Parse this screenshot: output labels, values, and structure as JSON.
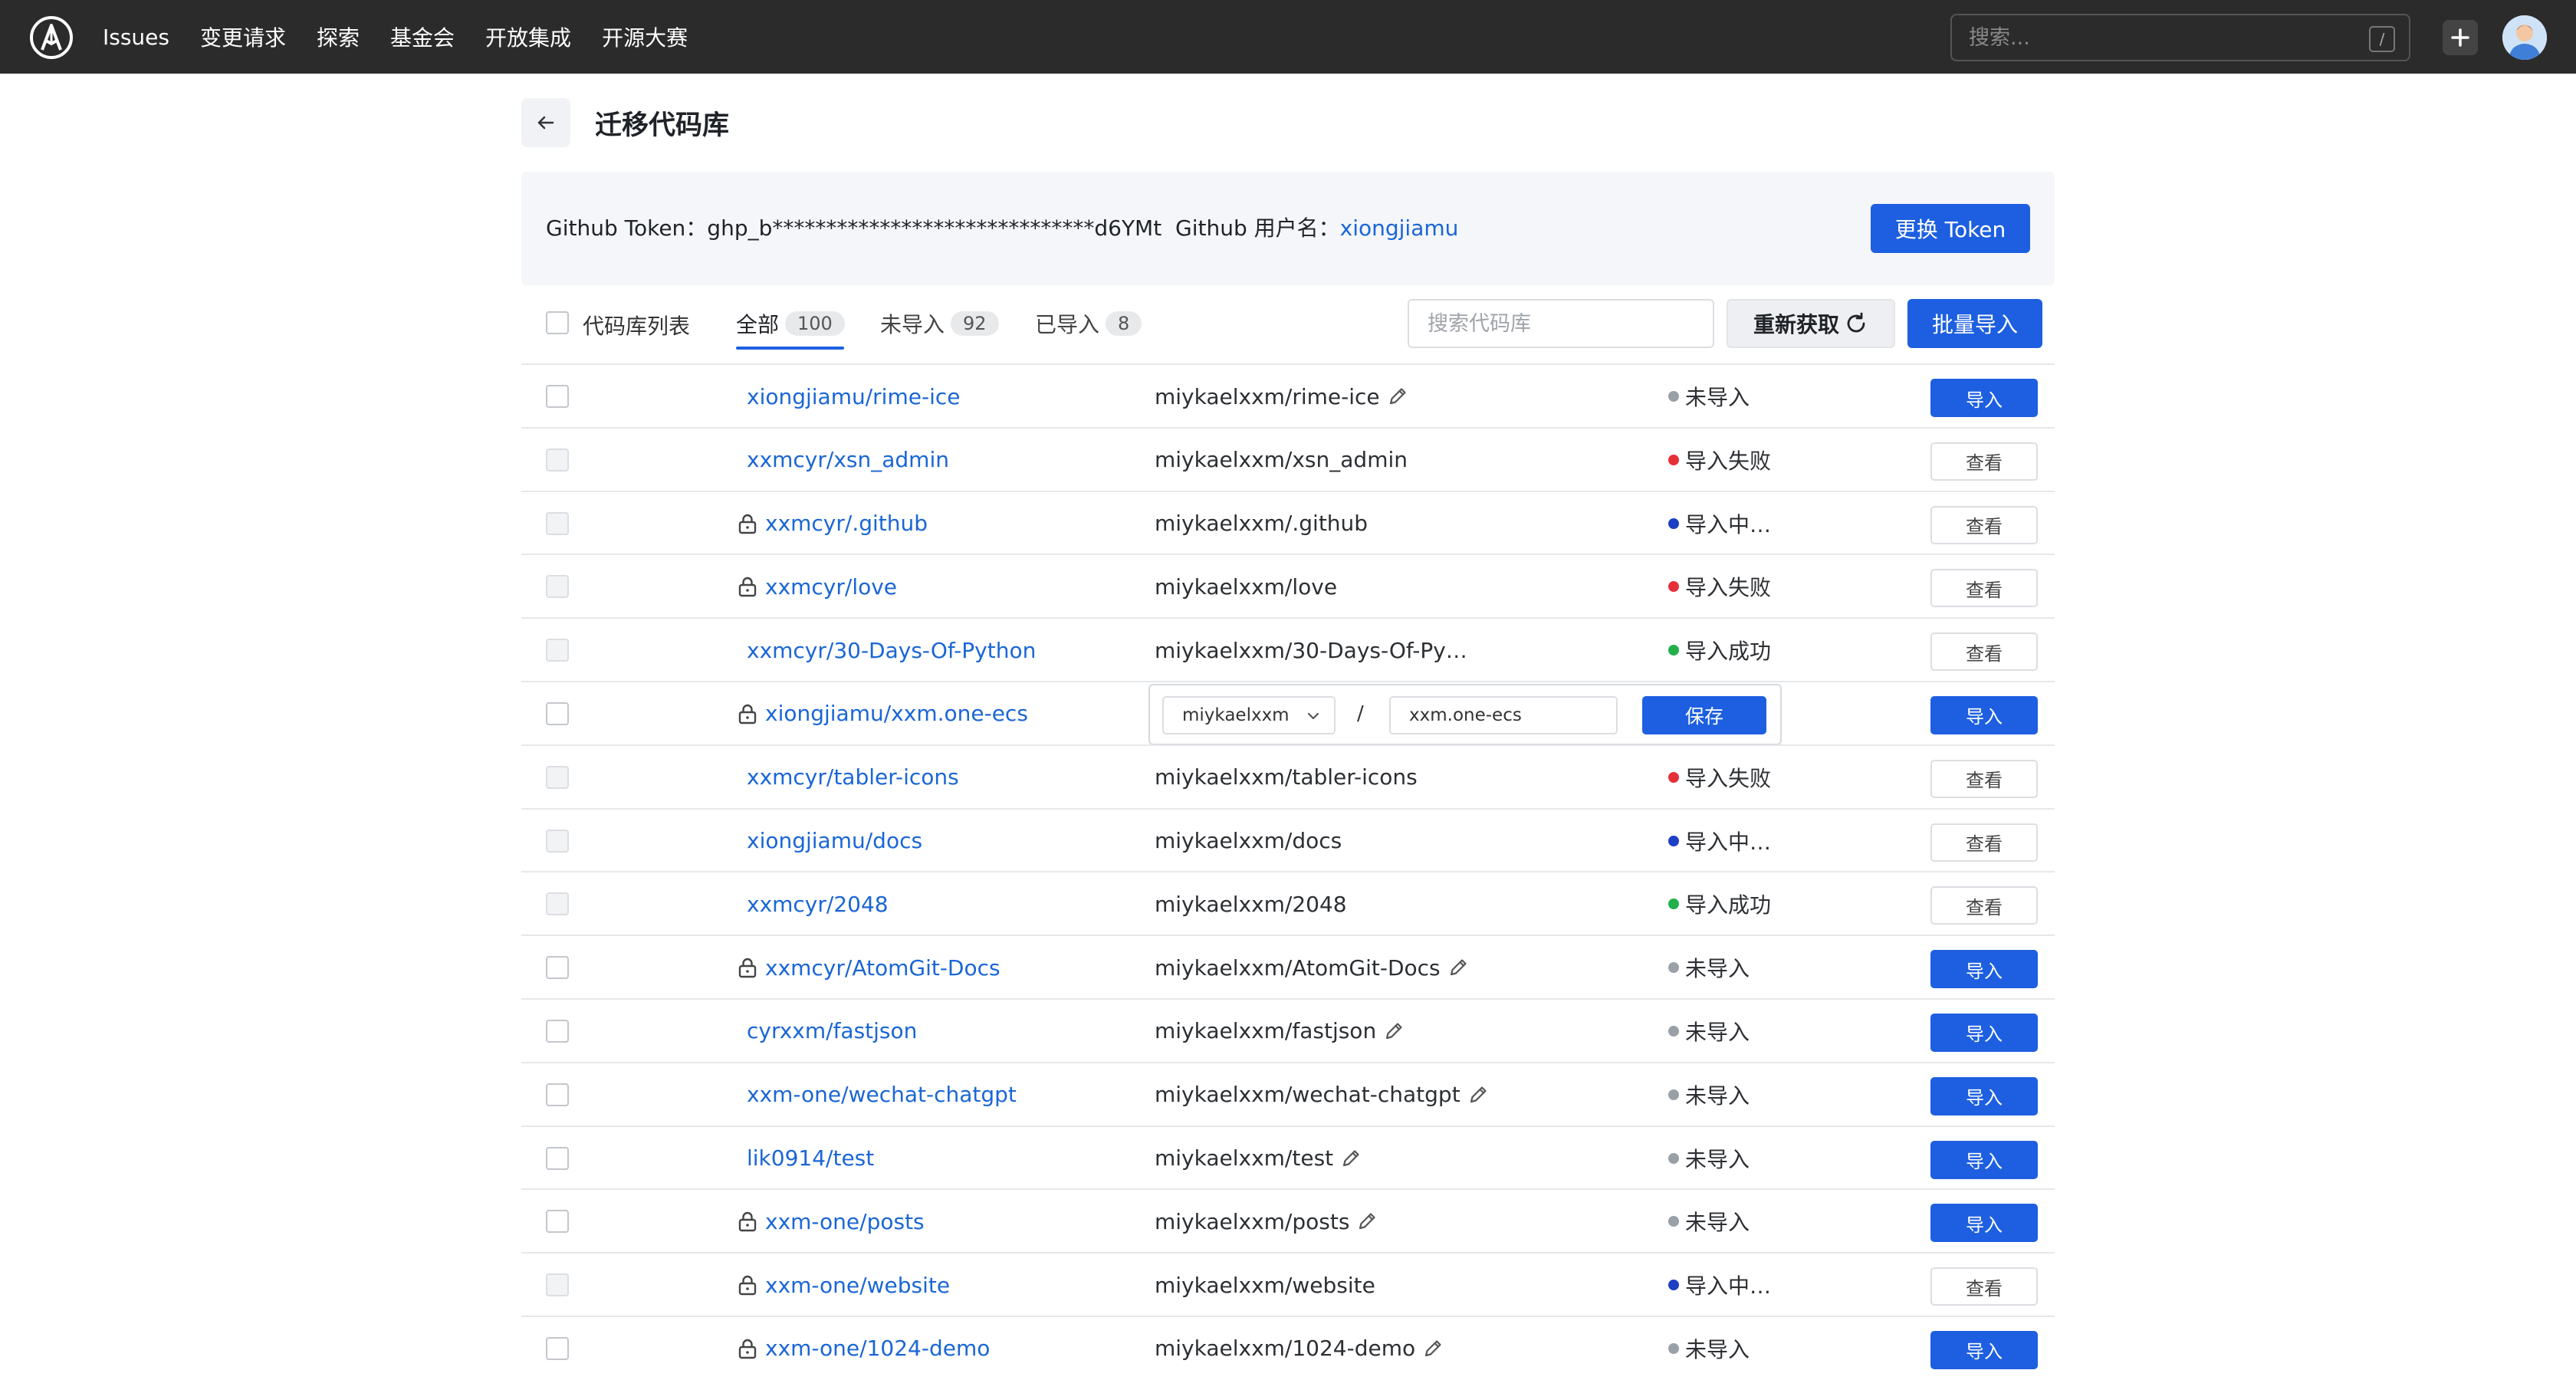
{
  "nav": {
    "items": [
      "Issues",
      "变更请求",
      "探索",
      "基金会",
      "开放集成",
      "开源大赛"
    ],
    "search_placeholder": "搜索...",
    "search_shortcut": "/"
  },
  "page": {
    "title": "迁移代码库"
  },
  "token": {
    "token_label": "Github Token：",
    "token_value": "ghp_b******************************d6YMt",
    "username_label": "Github 用户名：",
    "username": "xiongjiamu",
    "change_button": "更换 Token"
  },
  "filters": {
    "list_label": "代码库列表",
    "tabs": [
      {
        "label": "全部",
        "count": "100"
      },
      {
        "label": "未导入",
        "count": "92"
      },
      {
        "label": "已导入",
        "count": "8"
      }
    ],
    "search_placeholder": "搜索代码库",
    "refetch_button": "重新获取",
    "batch_button": "批量导入"
  },
  "colors": {
    "primary": "#1d5fe0",
    "link": "#1a66d6",
    "status_pending": "#9aa0a8",
    "status_failed": "#e5303a",
    "status_importing": "#1d3fc4",
    "status_success": "#22b04b"
  },
  "edit_row": {
    "namespace": "miykaelxxm",
    "separator": "/",
    "repo_name": "xxm.one-ecs",
    "save_button": "保存"
  },
  "rows": [
    {
      "source": "xiongjiamu/rime-ice",
      "locked": false,
      "target": "miykaelxxm/rime-ice",
      "editable": true,
      "status": "未导入",
      "status_type": "pending",
      "action": "导入",
      "selectable": true
    },
    {
      "source": "xxmcyr/xsn_admin",
      "locked": false,
      "target": "miykaelxxm/xsn_admin",
      "editable": false,
      "status": "导入失败",
      "status_type": "failed",
      "action": "查看",
      "selectable": false
    },
    {
      "source": "xxmcyr/.github",
      "locked": true,
      "target": "miykaelxxm/.github",
      "editable": false,
      "status": "导入中…",
      "status_type": "importing",
      "action": "查看",
      "selectable": false
    },
    {
      "source": "xxmcyr/love",
      "locked": true,
      "target": "miykaelxxm/love",
      "editable": false,
      "status": "导入失败",
      "status_type": "failed",
      "action": "查看",
      "selectable": false
    },
    {
      "source": "xxmcyr/30-Days-Of-Python",
      "locked": false,
      "target": "miykaelxxm/30-Days-Of-Py…",
      "editable": false,
      "status": "导入成功",
      "status_type": "success",
      "action": "查看",
      "selectable": false
    },
    {
      "source": "xiongjiamu/xxm.one-ecs",
      "locked": true,
      "target": "",
      "editable": false,
      "editing": true,
      "status": "",
      "status_type": "",
      "action": "导入",
      "selectable": true
    },
    {
      "source": "xxmcyr/tabler-icons",
      "locked": false,
      "target": "miykaelxxm/tabler-icons",
      "editable": false,
      "status": "导入失败",
      "status_type": "failed",
      "action": "查看",
      "selectable": false
    },
    {
      "source": "xiongjiamu/docs",
      "locked": false,
      "target": "miykaelxxm/docs",
      "editable": false,
      "status": "导入中…",
      "status_type": "importing",
      "action": "查看",
      "selectable": false
    },
    {
      "source": "xxmcyr/2048",
      "locked": false,
      "target": "miykaelxxm/2048",
      "editable": false,
      "status": "导入成功",
      "status_type": "success",
      "action": "查看",
      "selectable": false
    },
    {
      "source": "xxmcyr/AtomGit-Docs",
      "locked": true,
      "target": "miykaelxxm/AtomGit-Docs",
      "editable": true,
      "status": "未导入",
      "status_type": "pending",
      "action": "导入",
      "selectable": true
    },
    {
      "source": "cyrxxm/fastjson",
      "locked": false,
      "target": "miykaelxxm/fastjson",
      "editable": true,
      "status": "未导入",
      "status_type": "pending",
      "action": "导入",
      "selectable": true
    },
    {
      "source": "xxm-one/wechat-chatgpt",
      "locked": false,
      "target": "miykaelxxm/wechat-chatgpt",
      "editable": true,
      "status": "未导入",
      "status_type": "pending",
      "action": "导入",
      "selectable": true
    },
    {
      "source": "lik0914/test",
      "locked": false,
      "target": "miykaelxxm/test",
      "editable": true,
      "status": "未导入",
      "status_type": "pending",
      "action": "导入",
      "selectable": true
    },
    {
      "source": "xxm-one/posts",
      "locked": true,
      "target": "miykaelxxm/posts",
      "editable": true,
      "status": "未导入",
      "status_type": "pending",
      "action": "导入",
      "selectable": true
    },
    {
      "source": "xxm-one/website",
      "locked": true,
      "target": "miykaelxxm/website",
      "editable": false,
      "status": "导入中…",
      "status_type": "importing",
      "action": "查看",
      "selectable": false
    },
    {
      "source": "xxm-one/1024-demo",
      "locked": true,
      "target": "miykaelxxm/1024-demo",
      "editable": true,
      "status": "未导入",
      "status_type": "pending",
      "action": "导入",
      "selectable": true
    }
  ]
}
